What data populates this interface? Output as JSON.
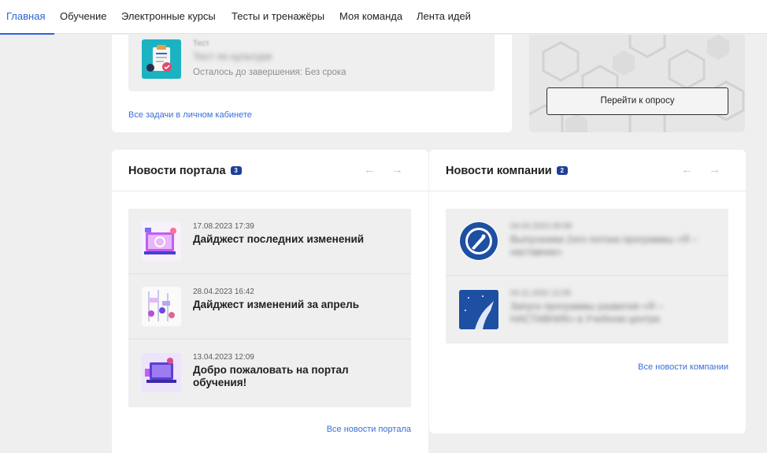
{
  "nav": {
    "tabs": [
      {
        "label": "Главная",
        "active": true
      },
      {
        "label": "Обучение"
      },
      {
        "label": "Электронные курсы"
      },
      {
        "label": "Тесты и тренажёры"
      },
      {
        "label": "Моя команда"
      },
      {
        "label": "Лента идей"
      }
    ]
  },
  "tasks": {
    "item": {
      "type": "Тест",
      "title": "Тест по культуре",
      "deadline": "Осталось до завершения: Без срока",
      "icon": "test-clipboard-icon"
    },
    "all_link": "Все задачи в личном кабинете"
  },
  "survey": {
    "button_label": "Перейти к опросу"
  },
  "portal_news": {
    "title": "Новости портала",
    "count": "3",
    "items": [
      {
        "date": "17.08.2023 17:39",
        "headline": "Дайджест последних изменений"
      },
      {
        "date": "28.04.2023 16:42",
        "headline": "Дайджест изменений за апрель"
      },
      {
        "date": "13.04.2023 12:09",
        "headline": "Добро пожаловать на портал обучения!"
      }
    ],
    "all_link": "Все новости портала"
  },
  "company_news": {
    "title": "Новости компании",
    "count": "2",
    "items": [
      {
        "date": "04.04.2023 09:08",
        "headline": "Выпускники 2ого потока программы «Я – наставник»"
      },
      {
        "date": "04.11.2022 12:00",
        "headline": "Запуск программы развития «Я – НАСТАВНИК» в Учебном центре"
      }
    ],
    "all_link": "Все новости компании"
  },
  "colors": {
    "accent": "#2b64d8",
    "badge": "#1c3f9c",
    "page_bg": "#efefef"
  }
}
